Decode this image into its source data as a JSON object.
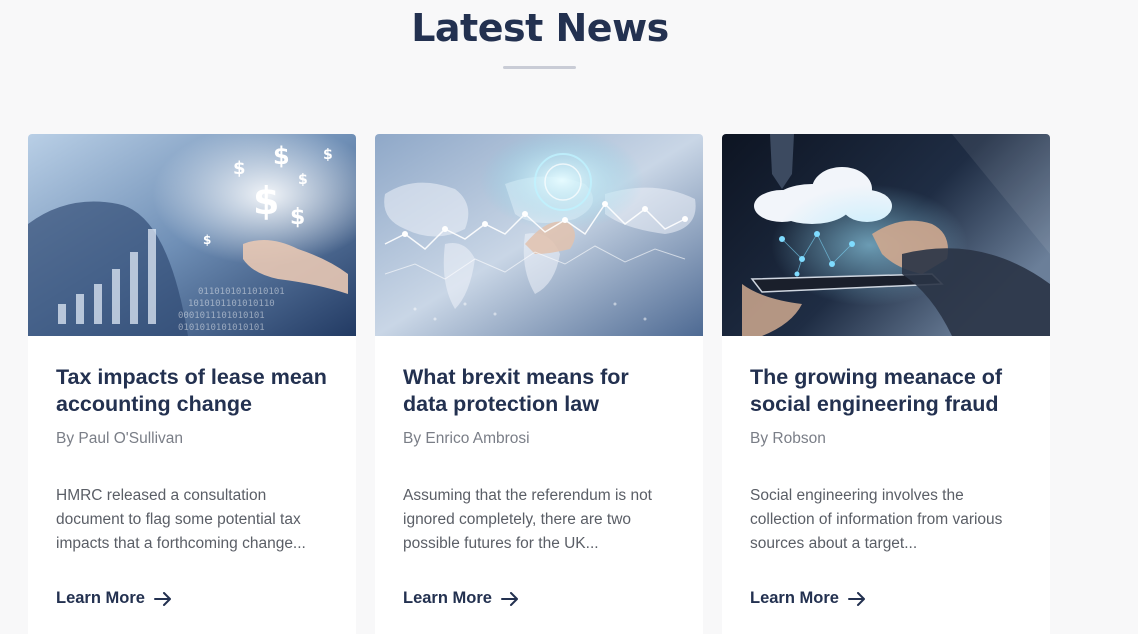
{
  "section": {
    "title": "Latest News"
  },
  "cards": [
    {
      "image_icon": "finance-dollar-chart-image",
      "title": "Tax impacts of lease mean accounting change",
      "author": "By Paul O'Sullivan",
      "excerpt": "HMRC released a consultation document to flag some potential tax impacts that a forthcoming change...",
      "link_label": "Learn More"
    },
    {
      "image_icon": "world-map-data-image",
      "title": "What brexit means for data protection law",
      "author": "By Enrico Ambrosi",
      "excerpt": "Assuming that the referendum is not ignored completely, there are two possible futures for the UK...",
      "link_label": "Learn More"
    },
    {
      "image_icon": "cloud-tablet-image",
      "title": "The growing meanace of social engineering fraud",
      "author": "By Robson",
      "excerpt": "Social engineering involves the collection of information from various sources about a target...",
      "link_label": "Learn More"
    }
  ],
  "colors": {
    "heading": "#233150",
    "author": "#7a7e87",
    "excerpt": "#5a5e66",
    "background": "#f8f8f9",
    "card": "#ffffff"
  }
}
